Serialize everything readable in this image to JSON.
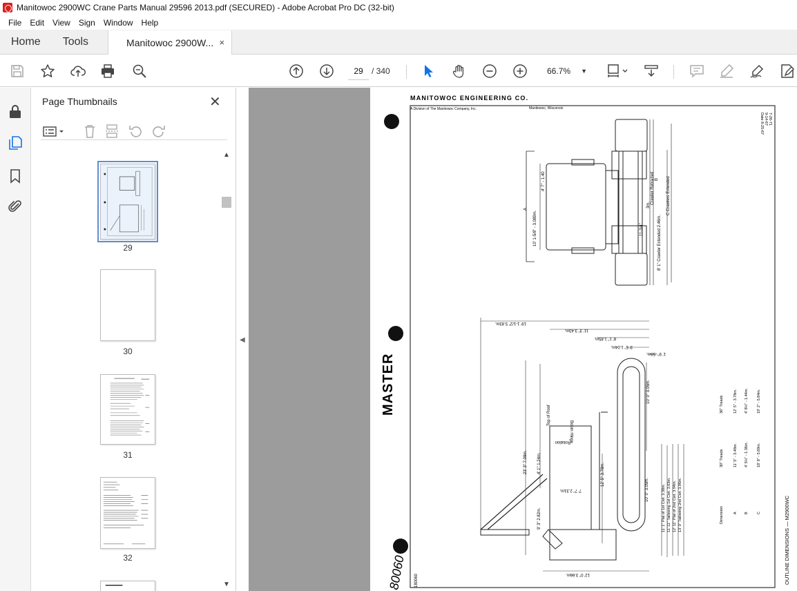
{
  "window": {
    "title": "Manitowoc 2900WC Crane Parts Manual 29596 2013.pdf (SECURED) - Adobe Acrobat Pro DC (32-bit)"
  },
  "menu": [
    "File",
    "Edit",
    "View",
    "Sign",
    "Window",
    "Help"
  ],
  "tabs": {
    "home": "Home",
    "tools": "Tools",
    "document": "Manitowoc 2900W...",
    "close_symbol": "×"
  },
  "toolbar": {
    "icons": [
      "save-icon",
      "bookmark-star-icon",
      "upload-cloud-icon",
      "print-icon",
      "zoom-search-icon",
      "page-up-icon",
      "page-down-icon",
      "select-arrow-icon",
      "hand-icon",
      "zoom-out-icon",
      "zoom-in-icon",
      "fit-page-icon",
      "scrolling-mode-icon",
      "comment-icon",
      "highlight-icon",
      "sign-icon",
      "edit-pdf-icon"
    ],
    "current_page": "29",
    "total_pages": "/ 340",
    "zoom": "66.7%"
  },
  "sidebar": {
    "rail_icons": [
      "lock-icon",
      "page-thumbnails-icon",
      "bookmark-icon",
      "attachment-icon"
    ],
    "panel_title": "Page Thumbnails",
    "close_symbol": "✕",
    "thumbnails": [
      {
        "page": "29",
        "selected": true
      },
      {
        "page": "30",
        "selected": false
      },
      {
        "page": "31",
        "selected": false
      },
      {
        "page": "32",
        "selected": false
      }
    ]
  },
  "document": {
    "company": "MANITOWOC ENGINEERING CO.",
    "division": "A Division of The Manitowoc Company, Inc.",
    "location": "Manitowoc, Wisconsin",
    "dates": [
      "7-26-71",
      "9-14-67",
      "Date 8-25-67"
    ],
    "stamp": "MASTER",
    "drawing_number": "80060",
    "drawing_number_small": "180060",
    "drawing_title": "OUTLINE DIMENSIONS — M2900WC",
    "top_view_labels": {
      "dim_a": "A",
      "dim_b": "B",
      "retracted": "Crawler Retracted",
      "extended": "C  Crawlers Extended",
      "extended_alt": "8' 1\" Crawler Extended 2.46m.",
      "d1": "10' 1-5/8\" - 3.089m.",
      "d2": "4' 7\" - 1.40",
      "d3": "3m.",
      "d4": "11-3/4\""
    },
    "side_view_labels": {
      "d_top": "19' 1-1/2\"  5.83m.",
      "d_1": "11' 3\"  3.43m.",
      "d_2": "6' 1\"  1.85m.",
      "d_3": "3' 5\"  1.04m.",
      "d_4": "1' 9\"  .58m.",
      "top_of_roof": "Top of Roof",
      "boom_hinge": "Boom Hinge",
      "rotation": "Rotation",
      "d_5": "23' 3\"  7.09m.",
      "d_6": "4' 1\"  1.24m.",
      "d_7": "9' 3\"  2.82m.",
      "d_8": "12' 5\"  3.78m.",
      "d_9": "7' 7\"  2.31m.",
      "d_10": "10' 0\"  3.05m.",
      "d_11": "10' 0\"  3.05m.",
      "d_12": "11' 1\"  Plat of 1st Cwt.  3.38m.",
      "d_13": "11' 11\"  Tailswing 1st Cwt.  3.63m.",
      "d_14": "12' 11\"  Plat of 2nd Cwt.  3.94m.",
      "d_15": "13' 0\"  Tailswing 2nd Cwt.  3.96m.",
      "d_bottom": "12' 0\"  3.66m."
    },
    "table": {
      "header_dim": "Dimension",
      "header_30": "30\" Treads",
      "header_36": "36\" Treads",
      "rows": [
        {
          "dim": "A",
          "t30": "11' 5\" - 3.48m.",
          "t36": "12' 5\" - 3.78m."
        },
        {
          "dim": "B",
          "t30": "4' 5½\" - 1.36m.",
          "t36": "4' 8½\" - 1.44m."
        },
        {
          "dim": "C",
          "t30": "18' 8\" - 5.69m.",
          "t36": "19' 2\" - 5.84m."
        }
      ]
    }
  }
}
